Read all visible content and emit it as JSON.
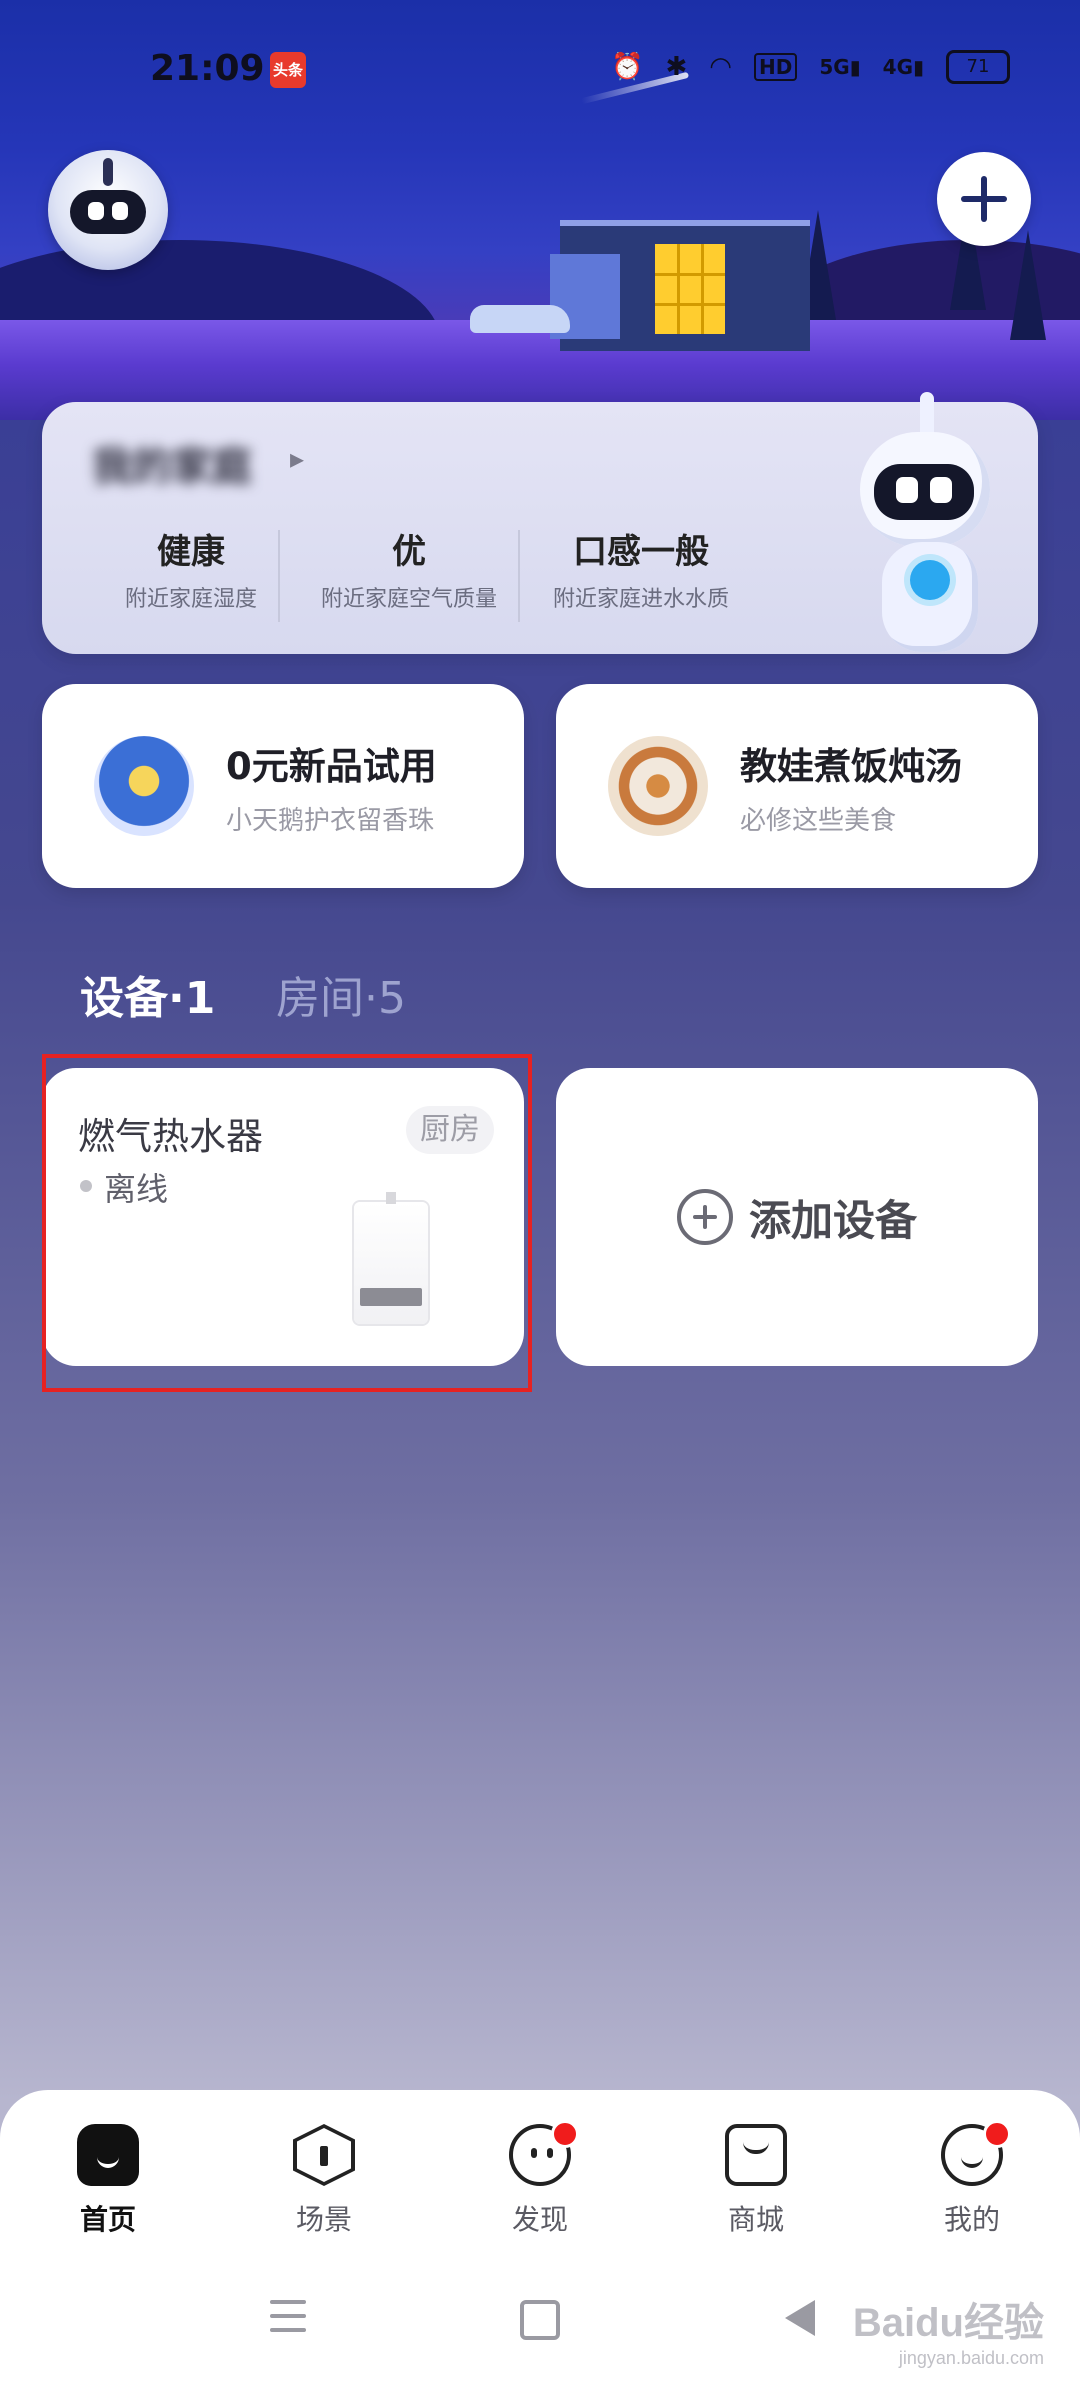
{
  "status_bar": {
    "time": "21:09",
    "news_badge": "头条",
    "battery": "71"
  },
  "header": {
    "avatar_icon": "robot-avatar-icon",
    "add_icon": "plus-icon"
  },
  "home_card": {
    "home_name": "我的家庭",
    "metrics": [
      {
        "value": "健康",
        "label": "附近家庭湿度"
      },
      {
        "value": "优",
        "label": "附近家庭空气质量"
      },
      {
        "value": "口感一般",
        "label": "附近家庭进水水质"
      }
    ]
  },
  "promos": [
    {
      "title": "0元新品试用",
      "subtitle": "小天鹅护衣留香珠",
      "icon": "trial-envelope-icon"
    },
    {
      "title": "教娃煮饭炖汤",
      "subtitle": "必修这些美食",
      "icon": "food-plate-icon"
    }
  ],
  "tabs": [
    {
      "label": "设备·1"
    },
    {
      "label": "房间·5"
    }
  ],
  "devices": [
    {
      "name": "燃气热水器",
      "room": "厨房",
      "status": "离线",
      "icon": "water-heater-icon"
    }
  ],
  "add_device": {
    "label": "添加设备"
  },
  "bottom_nav": [
    {
      "label": "首页",
      "icon": "home-icon",
      "active": true
    },
    {
      "label": "场景",
      "icon": "scene-icon",
      "active": false
    },
    {
      "label": "发现",
      "icon": "discover-icon",
      "active": false
    },
    {
      "label": "商城",
      "icon": "shop-bag-icon",
      "active": false
    },
    {
      "label": "我的",
      "icon": "profile-icon",
      "active": false
    }
  ],
  "watermark": {
    "brand": "Baidu经验",
    "url": "jingyan.baidu.com"
  },
  "colors": {
    "highlight": "#e62222",
    "notification_dot": "#f01c1c"
  }
}
